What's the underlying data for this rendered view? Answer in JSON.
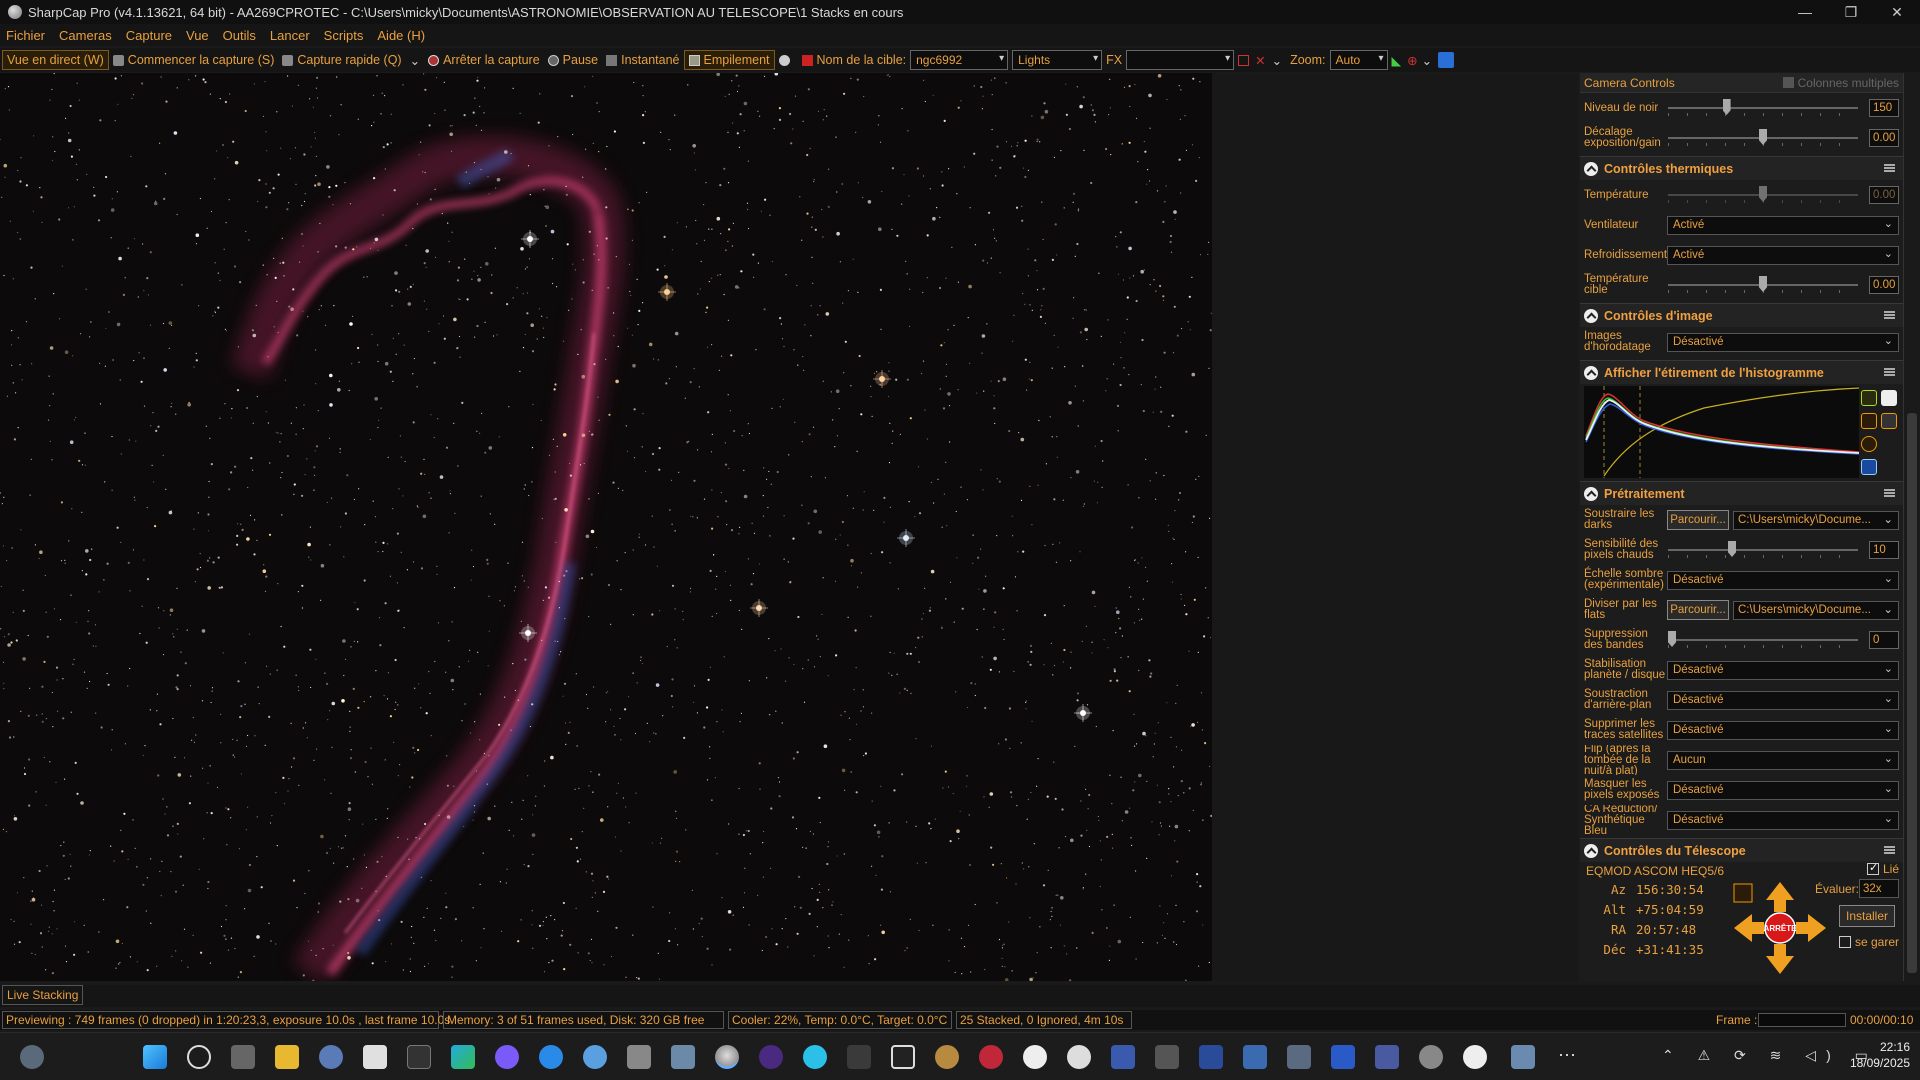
{
  "window": {
    "title": "SharpCap Pro (v4.1.13621, 64 bit) - AA269CPROTEC - C:\\Users\\micky\\Documents\\ASTRONOMIE\\OBSERVATION AU TELESCOPE\\1 Stacks en cours",
    "minimize": "—",
    "maximize": "❐",
    "close": "✕"
  },
  "menu": [
    "Fichier",
    "Cameras",
    "Capture",
    "Vue",
    "Outils",
    "Lancer",
    "Scripts",
    "Aide (H)"
  ],
  "toolbar": {
    "live_view": "Vue en direct (W)",
    "start_capture": "Commencer la capture (S)",
    "quick_capture": "Capture rapide (Q)",
    "stop_capture": "Arrêter la capture",
    "pause": "Pause",
    "snapshot": "Instantané",
    "stacking": "Empilement",
    "target_label": "Nom de la cible:",
    "target_value": "ngc6992",
    "frame_type": "Lights",
    "fx_label": "FX",
    "fx_value": "",
    "zoom_label": "Zoom:",
    "zoom_value": "Auto"
  },
  "panel": {
    "header": "Camera Controls",
    "multi_columns": "Colonnes multiples",
    "top_rows": [
      {
        "label": "Niveau de noir",
        "value": "150",
        "level": 0.3
      },
      {
        "label": "Décalage exposition/gain",
        "value": "0.00",
        "level": 0.5
      }
    ],
    "thermal": {
      "title": "Contrôles thermiques",
      "temperature_label": "Température",
      "temperature_value": "0.00",
      "fan_label": "Ventilateur",
      "fan_value": "Activé",
      "cooling_label": "Refroidissement",
      "cooling_value": "Activé",
      "target_temp_label": "Température cible",
      "target_temp_value": "0.00"
    },
    "image": {
      "title": "Contrôles d'image",
      "timestamp_label": "Images d'horodatage",
      "timestamp_value": "Désactivé"
    },
    "histogram": {
      "title": "Afficher l'étirement de l'histogramme"
    },
    "preprocessing": {
      "title": "Prétraitement",
      "darks_label": "Soustraire les darks",
      "browse": "Parcourir...",
      "darks_path": "C:\\Users\\micky\\Docume...",
      "hot_pixels_label": "Sensibilité des pixels chauds",
      "hot_pixels_value": "10",
      "dark_scale_label": "Échelle sombre (expérimentale)",
      "dark_scale_value": "Désactivé",
      "flats_label": "Diviser par les flats",
      "flats_path": "C:\\Users\\micky\\Docume...",
      "banding_label": "Suppression des bandes",
      "banding_value": "0",
      "stabilization_label": "Stabilisation planète / disque",
      "stabilization_value": "Désactivé",
      "background_label": "Soustraction d'arrière-plan",
      "background_value": "Désactivé",
      "satellite_label": "Supprimer les traces satellites",
      "satellite_value": "Désactivé",
      "flip_label": "Flip (après la tombée de la nuit/à plat)",
      "flip_value": "Aucun",
      "overexposed_label": "Masquer les pixels exposés",
      "overexposed_value": "Désactivé",
      "ca_label": "CA Réduction/ Synthétique Bleu",
      "ca_value": "Désactivé"
    },
    "telescope": {
      "title": "Contrôles du Télescope",
      "mount": "EQMOD ASCOM HEQ5/6",
      "linked": "Lié",
      "coords": [
        {
          "key": "Az",
          "value": "156:30:54"
        },
        {
          "key": "Alt",
          "value": "+75:04:59"
        },
        {
          "key": "RA",
          "value": "20:57:48"
        },
        {
          "key": "Déc",
          "value": "+31:41:35"
        }
      ],
      "stop": "ARRÊTE",
      "evaluate_label": "Évaluer:",
      "evaluate_value": "32x",
      "install": "Installer",
      "park": "se garer"
    }
  },
  "live_stacking_tab": "Live Stacking",
  "status": {
    "preview": "Previewing : 749 frames (0 dropped) in 1:20:23,3, exposure 10.0s , last frame 10.0s",
    "memory": "Memory: 3 of 51 frames used, Disk: 320 GB free",
    "cooler": "Cooler: 22%, Temp: 0.0°C, Target: 0.0°C",
    "stacked": "25 Stacked, 0 Ignored, 4m 10s",
    "frame_label": "Frame :",
    "frame_time": "00:00/00:10"
  },
  "tray": {
    "time": "22:16",
    "date": "18/09/2025"
  },
  "colors": {
    "accent": "#e8a040",
    "background": "#1a1a1a",
    "nebula": "#c83c6e"
  }
}
